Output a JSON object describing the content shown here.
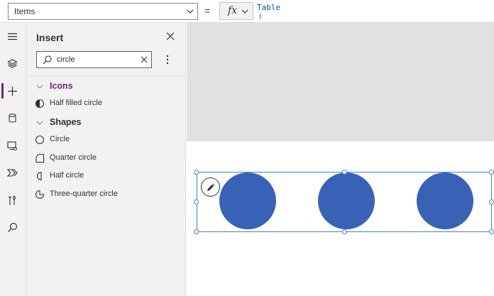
{
  "formula_bar": {
    "property": "Items",
    "equals": "=",
    "fx_label": "fx",
    "formula": "Table",
    "formula_cont": "("
  },
  "rail": {
    "items": [
      {
        "icon": "hamburger-icon"
      },
      {
        "icon": "layers-icon"
      },
      {
        "icon": "plus-icon",
        "active": true
      },
      {
        "icon": "database-icon"
      },
      {
        "icon": "media-icon"
      },
      {
        "icon": "power-automate-icon"
      },
      {
        "icon": "tools-icon"
      },
      {
        "icon": "search-icon"
      }
    ]
  },
  "insert_panel": {
    "title": "Insert",
    "search": {
      "value": "circle"
    },
    "categories": [
      {
        "label": "Icons",
        "items": [
          {
            "label": "Half filled circle"
          }
        ]
      },
      {
        "label": "Shapes",
        "items": [
          {
            "label": "Circle"
          },
          {
            "label": "Quarter circle"
          },
          {
            "label": "Half circle"
          },
          {
            "label": "Three-quarter circle"
          }
        ]
      }
    ]
  },
  "colors": {
    "accent": "#742774",
    "icons_category": "#742774",
    "shapes_category": "#323130",
    "circle_fill": "#3862b5",
    "selection": "#4a7fd0"
  }
}
